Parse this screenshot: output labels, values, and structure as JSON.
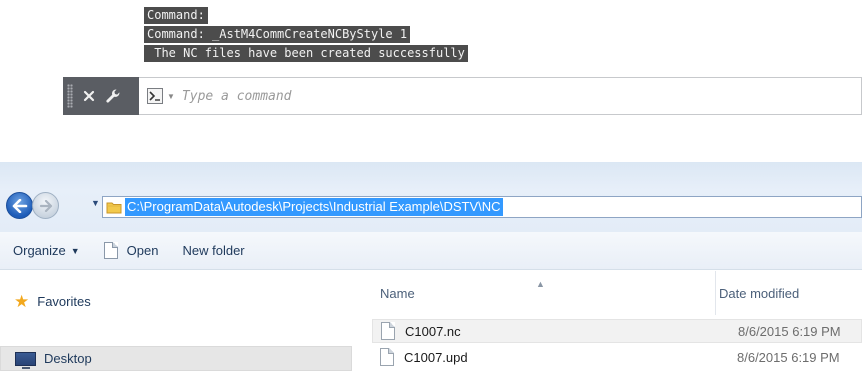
{
  "autocad": {
    "history": [
      "Command:",
      "Command: _AstM4CommCreateNCByStyle 1",
      " The NC files have been created successfully"
    ],
    "input_placeholder": "Type a command",
    "icons": [
      "grip-handle",
      "close-icon",
      "wrench-icon",
      "prompt-icon",
      "dropdown-arrow"
    ]
  },
  "explorer": {
    "address": "C:\\ProgramData\\Autodesk\\Projects\\Industrial Example\\DSTV\\NC",
    "toolbar": {
      "organize_label": "Organize",
      "open_label": "Open",
      "new_folder_label": "New folder"
    },
    "nav": {
      "favorites_label": "Favorites",
      "desktop_label": "Desktop"
    },
    "columns": {
      "name": "Name",
      "date_modified": "Date modified"
    },
    "files": [
      {
        "name": "C1007.nc",
        "date_modified": "8/6/2015 6:19 PM"
      },
      {
        "name": "C1007.upd",
        "date_modified": "8/6/2015 6:19 PM"
      }
    ],
    "colors": {
      "selection": "#3399ff",
      "chrome": "#dbe7f4",
      "command_bg": "#4c4c4c"
    }
  }
}
